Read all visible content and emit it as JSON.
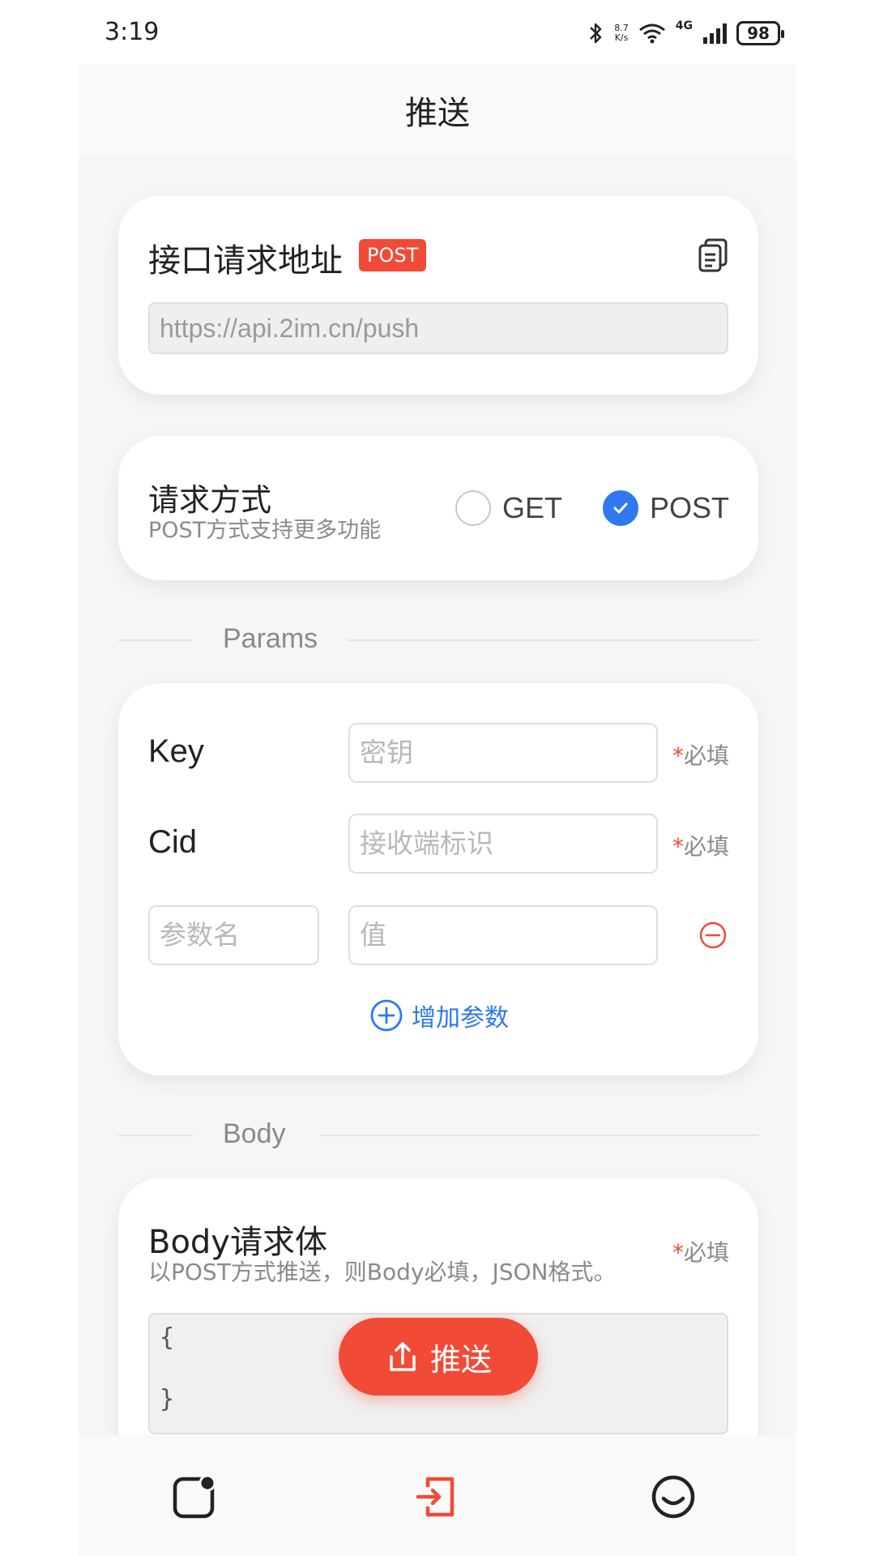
{
  "status_bar": {
    "time": "3:19",
    "net_speed_value": "8.7",
    "net_speed_unit": "K/s",
    "network": "4G",
    "battery": "98"
  },
  "header": {
    "title": "推送"
  },
  "url_card": {
    "title": "接口请求地址",
    "badge": "POST",
    "url_value": "https://api.2im.cn/push"
  },
  "method_card": {
    "title": "请求方式",
    "subtitle": "POST方式支持更多功能",
    "options": [
      {
        "label": "GET",
        "checked": false
      },
      {
        "label": "POST",
        "checked": true
      }
    ]
  },
  "params_section": {
    "label": "Params"
  },
  "params_card": {
    "key_label": "Key",
    "key_placeholder": "密钥",
    "cid_label": "Cid",
    "cid_placeholder": "接收端标识",
    "required_text": "必填",
    "required_star": "*",
    "param_name_placeholder": "参数名",
    "param_value_placeholder": "值",
    "add_param_label": "增加参数"
  },
  "body_section": {
    "label": "Body"
  },
  "body_card": {
    "title": "Body请求体",
    "subtitle": "以POST方式推送，则Body必填，JSON格式。",
    "required_text": "必填",
    "required_star": "*",
    "editor_value": "{\n\n}"
  },
  "push_button": {
    "label": "推送"
  },
  "colors": {
    "accent_red": "#f14a37",
    "accent_blue": "#2f78f0"
  },
  "icons": {
    "copy": "copy-icon",
    "minus": "minus-circle-icon",
    "add": "plus-circle-icon",
    "push": "upload-icon",
    "nav_left": "notification-square-icon",
    "nav_center": "login-icon",
    "nav_right": "smile-icon"
  }
}
